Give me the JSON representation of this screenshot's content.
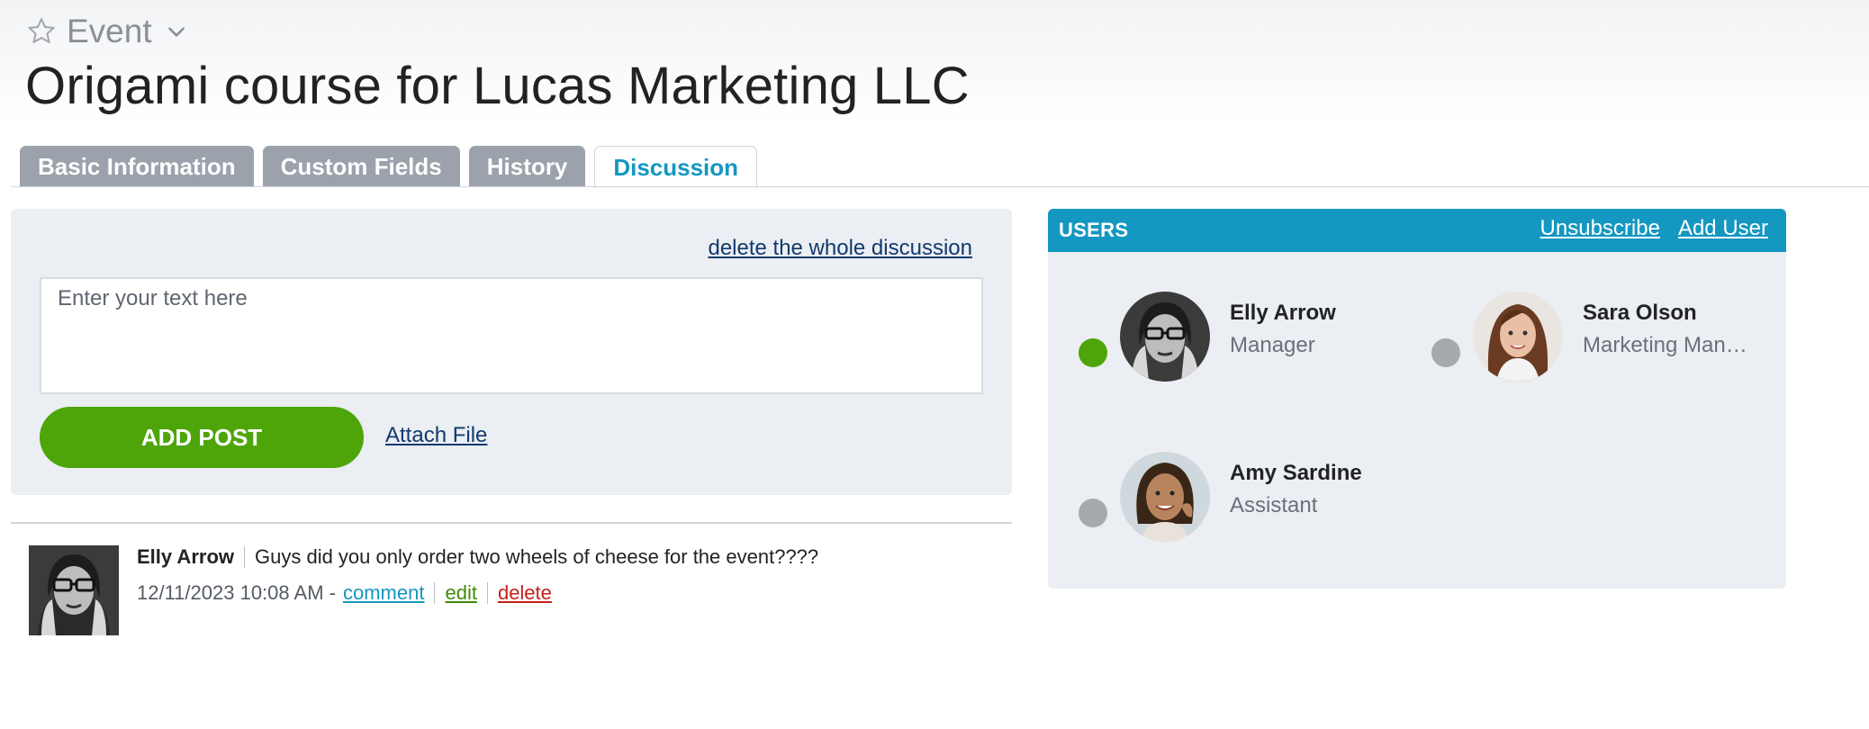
{
  "header": {
    "entity_type": "Event",
    "star_icon": "star-outline-icon",
    "dropdown_icon": "chevron-down-icon",
    "title": "Origami course for Lucas Marketing LLC"
  },
  "tabs": [
    {
      "label": "Basic Information",
      "active": false
    },
    {
      "label": "Custom Fields",
      "active": false
    },
    {
      "label": "History",
      "active": false
    },
    {
      "label": "Discussion",
      "active": true
    }
  ],
  "discussion": {
    "delete_all_label": "delete the whole discussion",
    "input_placeholder": "Enter your text here",
    "input_value": "",
    "add_post_label": "ADD POST",
    "attach_file_label": "Attach File"
  },
  "posts": [
    {
      "author": "Elly Arrow",
      "text": "Guys did you only order two wheels of cheese for the event????",
      "timestamp": "12/11/2023 10:08 AM -",
      "comment_label": "comment",
      "edit_label": "edit",
      "delete_label": "delete"
    }
  ],
  "users": {
    "title": "USERS",
    "unsubscribe_label": "Unsubscribe",
    "add_user_label": "Add User",
    "list": [
      {
        "name": "Elly Arrow",
        "role": "Manager",
        "online": true
      },
      {
        "name": "Sara Olson",
        "role": "Marketing Manager",
        "online": false
      },
      {
        "name": "Amy Sardine",
        "role": "Assistant",
        "online": false
      }
    ]
  },
  "colors": {
    "accent": "#1497c1",
    "success": "#4ea50a",
    "danger": "#c5211a",
    "tab_inactive": "#9ca2ab",
    "panel_bg": "#ebeef2",
    "status_online": "#4ea50a",
    "status_offline": "#a6a9ae"
  }
}
